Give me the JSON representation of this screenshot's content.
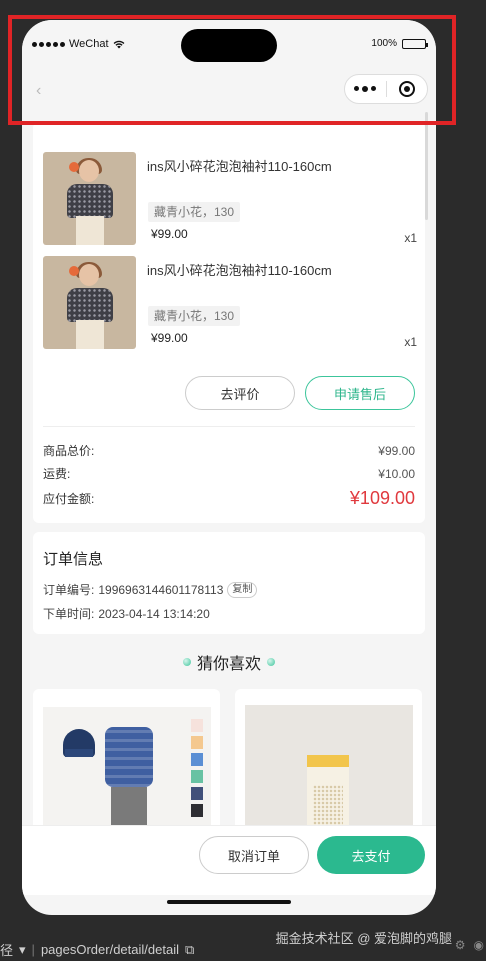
{
  "status_bar": {
    "carrier": "WeChat",
    "battery": "100%"
  },
  "nav": {
    "back": "‹"
  },
  "order_items": [
    {
      "title": "ins风小碎花泡泡袖衬110-160cm",
      "sku": "藏青小花，130",
      "price": "¥99.00",
      "qty": "x1"
    },
    {
      "title": "ins风小碎花泡泡袖衬110-160cm",
      "sku": "藏青小花，130",
      "price": "¥99.00",
      "qty": "x1"
    }
  ],
  "actions": {
    "review": "去评价",
    "after_sale": "申请售后"
  },
  "summary": {
    "goods_total_label": "商品总价:",
    "goods_total": "¥99.00",
    "shipping_label": "运费:",
    "shipping": "¥10.00",
    "payable_label": "应付金额:",
    "payable": "¥109.00"
  },
  "order_info": {
    "title": "订单信息",
    "order_no_label": "订单编号:",
    "order_no": "1996963144601178113",
    "copy": "复制",
    "time_label": "下单时间:",
    "time": "2023-04-14 13:14:20"
  },
  "guess_title": "猜你喜欢",
  "bottom": {
    "cancel": "取消订单",
    "pay": "去支付"
  },
  "devtools": {
    "path_label": "径",
    "path": "pagesOrder/detail/detail",
    "watermark": "掘金技术社区 @ 爱泡脚的鸡腿"
  },
  "colors": {
    "accent": "#2bb98f",
    "price_red": "#e0393e",
    "highlight": "#e02426"
  }
}
